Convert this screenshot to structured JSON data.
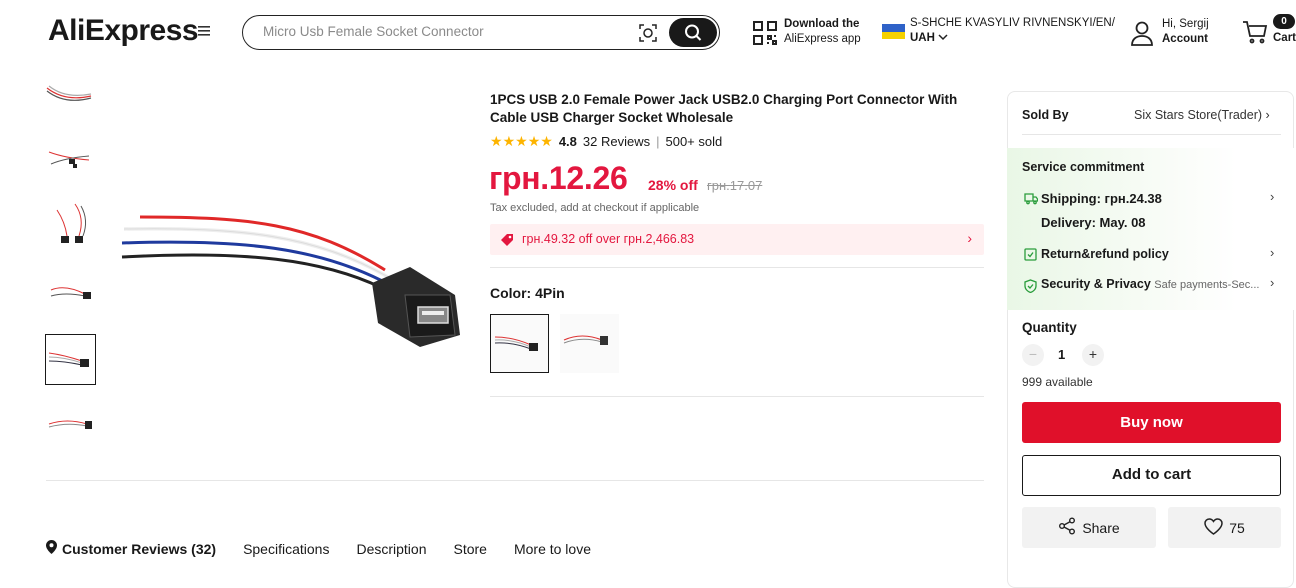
{
  "header": {
    "logo": "AliExpress",
    "search_placeholder": "Micro Usb Female Socket Connector",
    "app_line1": "Download the",
    "app_line2": "AliExpress app",
    "ship_to": "S-SHCHE KVASYLIV RIVNENSKYI/EN/",
    "currency": "UAH",
    "greeting": "Hi, Sergij",
    "account": "Account",
    "cart_count": "0",
    "cart_label": "Cart"
  },
  "product": {
    "title": "1PCS USB 2.0 Female Power Jack USB2.0 Charging Port Connector With Cable USB Charger Socket Wholesale",
    "rating": "4.8",
    "reviews": "32 Reviews",
    "sold": "500+ sold",
    "stars": 5,
    "price": "грн.12.26",
    "discount": "28% off",
    "original_price": "грн.17.07",
    "tax_note": "Tax excluded, add at checkout if applicable",
    "coupon": "грн.49.32 off over грн.2,466.83",
    "color_label": "Color:",
    "color_value": "4Pin",
    "selected_thumbnail": 5
  },
  "tabs": [
    "Customer Reviews (32)",
    "Specifications",
    "Description",
    "Store",
    "More to love"
  ],
  "panel": {
    "sold_by_label": "Sold By",
    "store": "Six Stars Store(Trader)",
    "service_title": "Service commitment",
    "shipping": "Shipping: грн.24.38",
    "delivery": "Delivery: May. 08",
    "refund": "Return&refund policy",
    "security": "Security & Privacy",
    "security_sub": "Safe payments-Sec...",
    "quantity_label": "Quantity",
    "quantity": "1",
    "available": "999 available",
    "buy_now": "Buy now",
    "add_to_cart": "Add to cart",
    "share": "Share",
    "wishlist_count": "75"
  },
  "colors": {
    "accent_red": "#e0102a",
    "price_red": "#e3173f",
    "star": "#fdb400"
  }
}
